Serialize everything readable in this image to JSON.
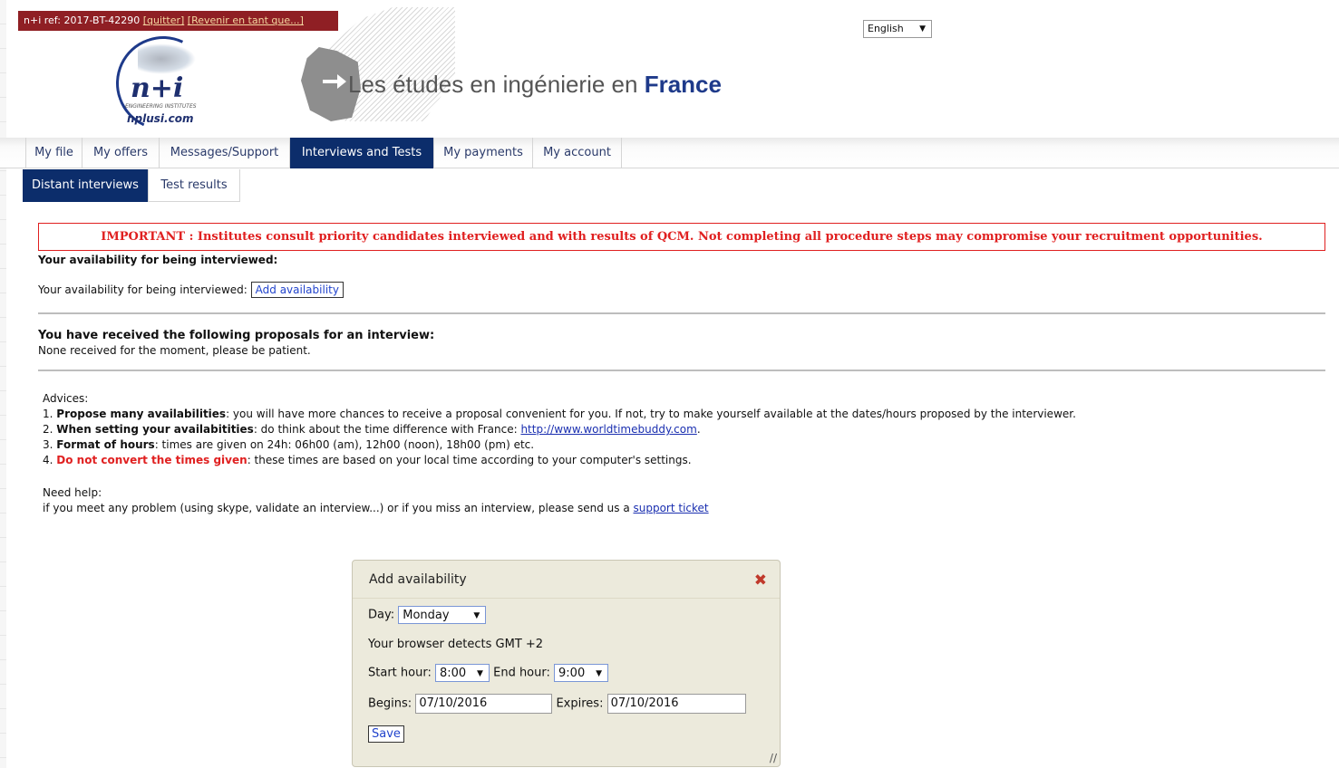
{
  "admin_bar": {
    "ref_label": "n+i ref: 2017-BT-42290",
    "quit_link": "[quitter]",
    "return_link": "[Revenir en tant que...]"
  },
  "logo": {
    "mark": "n+i",
    "subtitle": "ENGINEERING INSTITUTES",
    "url": "nplusi.com"
  },
  "header": {
    "title_prefix": "Les études en ingénierie en ",
    "title_emphasis": "France"
  },
  "language_select": {
    "value": "English"
  },
  "main_tabs": [
    {
      "label": "My file",
      "active": false
    },
    {
      "label": "My offers",
      "active": false
    },
    {
      "label": "Messages/Support",
      "active": false
    },
    {
      "label": "Interviews and Tests",
      "active": true
    },
    {
      "label": "My payments",
      "active": false
    },
    {
      "label": "My account",
      "active": false
    }
  ],
  "sub_tabs": [
    {
      "label": "Distant interviews",
      "active": true
    },
    {
      "label": "Test results",
      "active": false
    }
  ],
  "notice": {
    "text": "IMPORTANT : Institutes consult priority candidates interviewed and with results of QCM. Not completing all procedure steps may compromise your recruitment opportunities."
  },
  "availability": {
    "heading": "Your availability for being interviewed:",
    "label": "Your availability for being interviewed:",
    "button": "Add availability"
  },
  "proposals": {
    "heading": "You have received the following proposals for an interview:",
    "status": "None received for the moment, please be patient."
  },
  "advices": {
    "title": "Advices:",
    "items": [
      {
        "num": "1.",
        "strong": "Propose many availabilities",
        "text": ": you will have more chances to receive a proposal convenient for you. If not, try to make yourself available at the dates/hours proposed by the interviewer."
      },
      {
        "num": "2.",
        "strong": "When setting your availabitities",
        "text": ": do think about the time difference with France: ",
        "link": "http://www.worldtimebuddy.com",
        "after": "."
      },
      {
        "num": "3.",
        "strong": "Format of hours",
        "text": ": times are given on 24h: 06h00 (am), 12h00 (noon), 18h00 (pm) etc."
      },
      {
        "num": "4.",
        "strong": "Do not convert the times given",
        "text": ": these times are based on your local time according to your computer's settings."
      }
    ]
  },
  "help": {
    "title": "Need help:",
    "text": "if you meet any problem (using skype, validate an interview...) or if you miss an interview, please send us a ",
    "link": "support ticket"
  },
  "dialog": {
    "title": "Add availability",
    "day_label": "Day:",
    "day_value": "Monday",
    "gmt_text": "Your browser detects GMT +2",
    "start_label": "Start hour:",
    "start_value": "8:00",
    "end_label": "End hour:",
    "end_value": "9:00",
    "begins_label": "Begins:",
    "begins_value": "07/10/2016",
    "expires_label": "Expires:",
    "expires_value": "07/10/2016",
    "save_label": "Save"
  },
  "colors": {
    "nav_active": "#0c2d6b",
    "alert_red": "#e02020",
    "admin_bar": "#8f1f24",
    "dialog_bg": "#eceadc"
  }
}
